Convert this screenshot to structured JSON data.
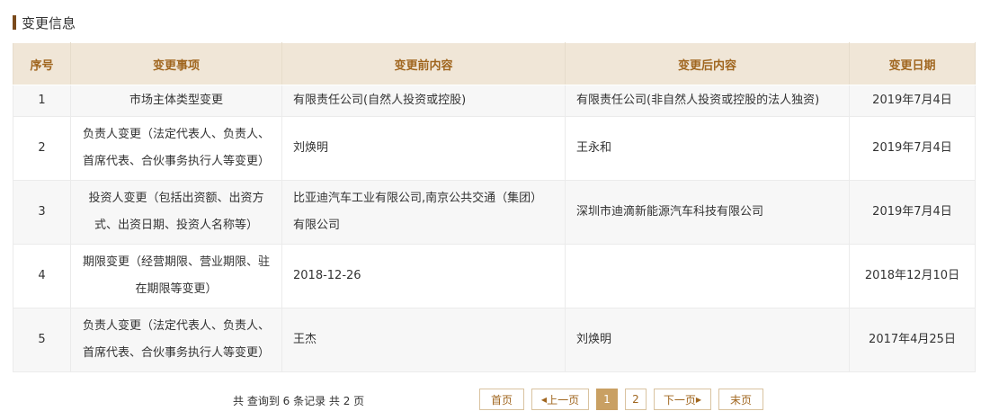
{
  "section": {
    "title": "变更信息"
  },
  "table": {
    "headers": [
      "序号",
      "变更事项",
      "变更前内容",
      "变更后内容",
      "变更日期"
    ],
    "rows": [
      {
        "no": "1",
        "item": "市场主体类型变更",
        "before": "有限责任公司(自然人投资或控股)",
        "after": "有限责任公司(非自然人投资或控股的法人独资)",
        "date": "2019年7月4日"
      },
      {
        "no": "2",
        "item": "负责人变更（法定代表人、负责人、首席代表、合伙事务执行人等变更）",
        "before": "刘焕明",
        "after": "王永和",
        "date": "2019年7月4日"
      },
      {
        "no": "3",
        "item": "投资人变更（包括出资额、出资方式、出资日期、投资人名称等）",
        "before": "比亚迪汽车工业有限公司,南京公共交通（集团）有限公司",
        "after": "深圳市迪滴新能源汽车科技有限公司",
        "date": "2019年7月4日"
      },
      {
        "no": "4",
        "item": "期限变更（经营期限、营业期限、驻在期限等变更）",
        "before": "2018-12-26",
        "after": "",
        "date": "2018年12月10日"
      },
      {
        "no": "5",
        "item": "负责人变更（法定代表人、负责人、首席代表、合伙事务执行人等变更）",
        "before": "王杰",
        "after": "刘焕明",
        "date": "2017年4月25日"
      }
    ]
  },
  "pagination": {
    "summary": "共 查询到 6 条记录 共 2 页",
    "first": "首页",
    "prev": "上一页",
    "pages": [
      "1",
      "2"
    ],
    "current_page": "1",
    "next": "下一页",
    "last": "末页"
  },
  "colors": {
    "accent": "#a0661f",
    "header_bg": "#f0e6d7",
    "active_page": "#c9a063",
    "title_bar": "#7a4a1c"
  }
}
